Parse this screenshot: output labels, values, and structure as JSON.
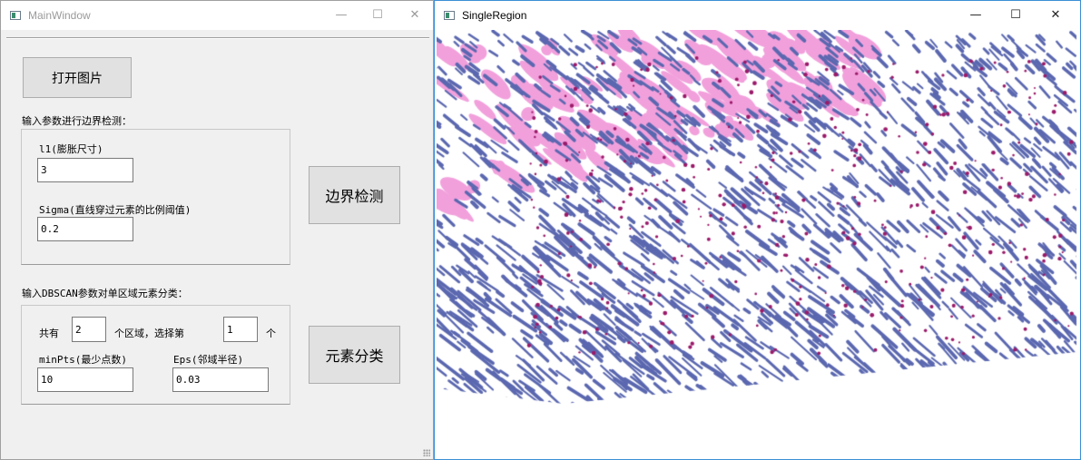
{
  "main_window": {
    "title": "MainWindow",
    "controls": {
      "minimize": "—",
      "maximize": "☐",
      "close": "✕"
    },
    "open_button": "打开图片",
    "section1_title": "输入参数进行边界检测：",
    "l1_label": "l1(膨胀尺寸)",
    "l1_value": "3",
    "sigma_label": "Sigma(直线穿过元素的比例阈值)",
    "sigma_value": "0.2",
    "edge_button": "边界检测",
    "section2_title": "输入DBSCAN参数对单区域元素分类：",
    "total_prefix": "共有",
    "total_value": "2",
    "total_suffix": "个区域，选择第",
    "select_value": "1",
    "select_suffix": "个",
    "minpts_label": "minPts(最少点数)",
    "minpts_value": "10",
    "eps_label": "Eps(邻域半径)",
    "eps_value": "0.03",
    "classify_button": "元素分类"
  },
  "region_window": {
    "title": "SingleRegion",
    "controls": {
      "minimize": "—",
      "maximize": "☐",
      "close": "✕"
    },
    "colors": {
      "blue": "#5b68b0",
      "pink": "#f2a0dc",
      "dark": "#9b1a6a",
      "background": "#ffffff"
    }
  }
}
